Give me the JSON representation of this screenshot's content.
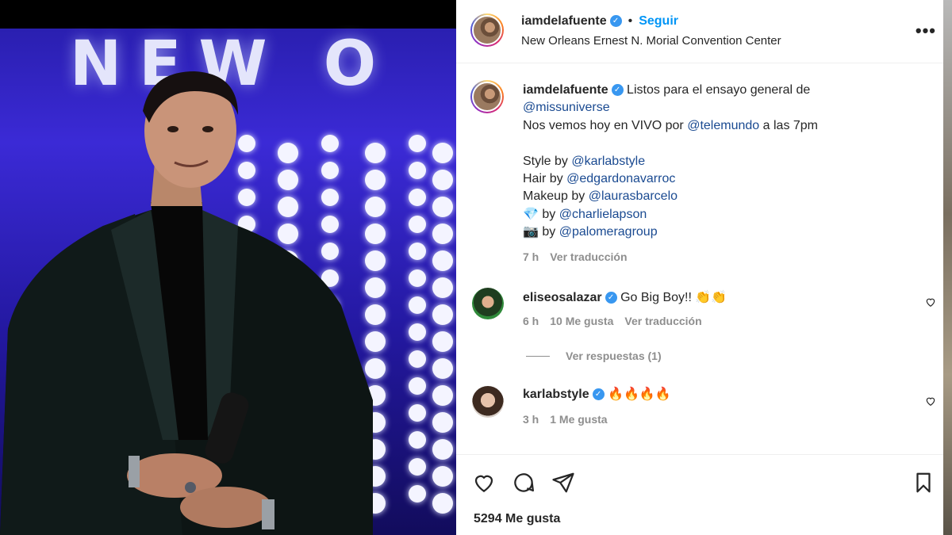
{
  "post": {
    "author": "iamdelafuente",
    "follow_label": "Seguir",
    "separator": "•",
    "location": "New Orleans Ernest N. Morial Convention Center",
    "more_label": "•••",
    "photo_text": "NEW O"
  },
  "caption": {
    "username": "iamdelafuente",
    "line1_text": "Listos para el ensayo general de",
    "line2_mention": "@missuniverse",
    "line3_pre": "Nos vemos hoy en VIVO por",
    "line3_mention": "@telemundo",
    "line3_post": "a las 7pm",
    "credits": [
      {
        "prefix": "Style by",
        "handle": "@karlabstyle"
      },
      {
        "prefix": "Hair by",
        "handle": "@edgardonavarroc"
      },
      {
        "prefix": "Makeup by",
        "handle": "@laurasbarcelo"
      },
      {
        "prefix": "💎 by",
        "handle": "@charlielapson"
      },
      {
        "prefix": "📷 by",
        "handle": "@palomeragroup"
      }
    ],
    "time": "7 h",
    "translate": "Ver traducción"
  },
  "comments": [
    {
      "username": "eliseosalazar",
      "text": "Go Big Boy!! 👏👏",
      "time": "6 h",
      "likes": "10 Me gusta",
      "translate": "Ver traducción",
      "replies": "Ver respuestas (1)"
    },
    {
      "username": "karlabstyle",
      "text": "🔥🔥🔥🔥",
      "time": "3 h",
      "likes": "1 Me gusta"
    }
  ],
  "footer": {
    "likes_count": "5294 Me gusta"
  },
  "colors": {
    "link": "#0095f6",
    "mention": "#1a4a91",
    "verified": "#3897f0",
    "muted": "#8e8e8e"
  }
}
